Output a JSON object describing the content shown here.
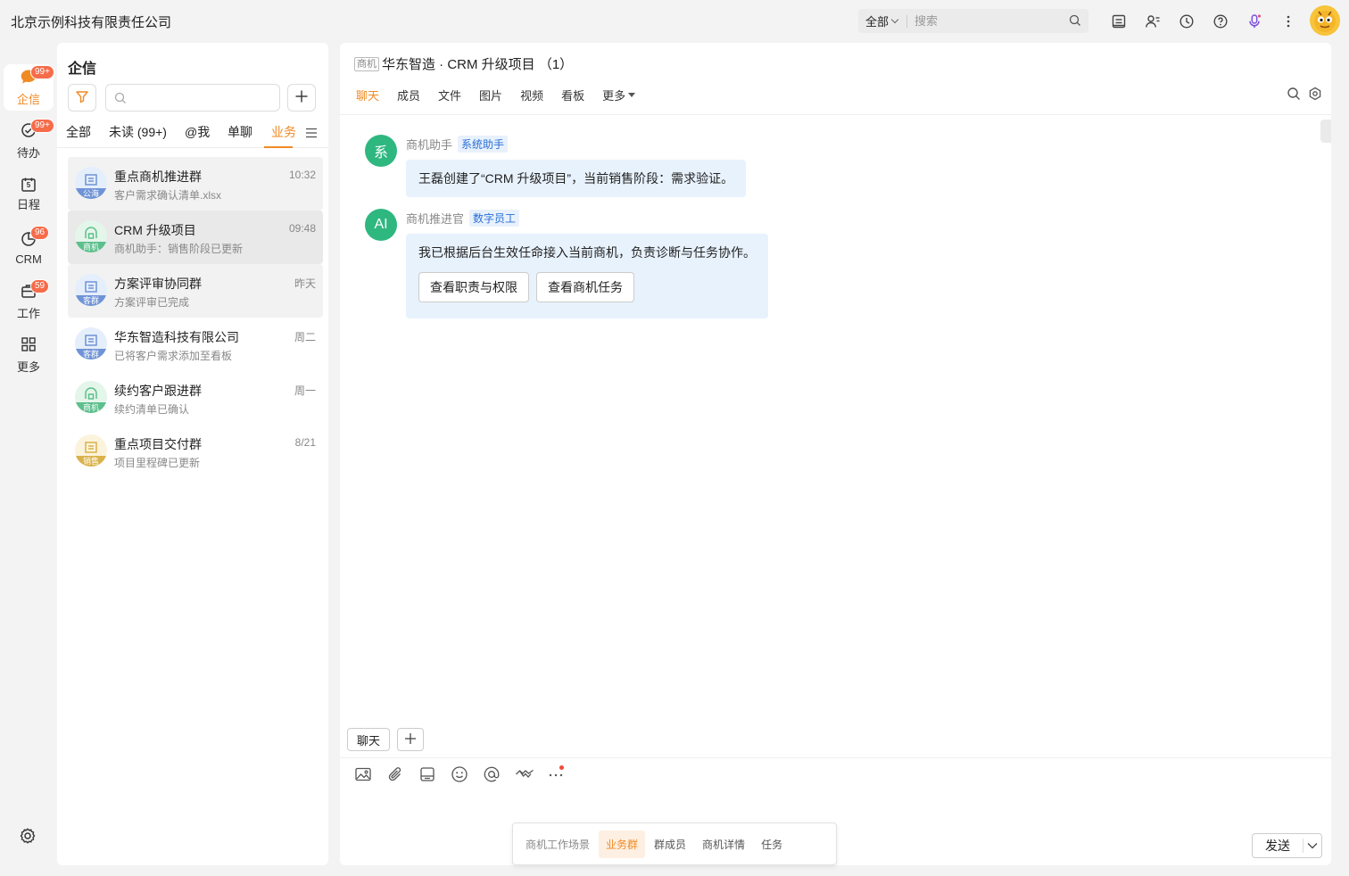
{
  "colors": {
    "accent": "#f08a24",
    "badge": "#f56c4a",
    "bubble": "#e8f2fd",
    "avatar_green": "#2fb780",
    "role_tag": "#2a6fd6"
  },
  "topbar": {
    "company": "北京示例科技有限责任公司",
    "search_scope": "全部",
    "search_placeholder": "搜索",
    "icons": [
      "notes-icon",
      "contacts-icon",
      "clock-icon",
      "help-icon",
      "mic-icon",
      "more-vertical-icon"
    ]
  },
  "rail": {
    "items": [
      {
        "label": "企信",
        "icon": "chat-bubble-icon",
        "badge": "99+"
      },
      {
        "label": "待办",
        "icon": "check-circle-icon",
        "badge": "99+"
      },
      {
        "label": "日程",
        "icon": "calendar-icon",
        "badge": "",
        "day": "5"
      },
      {
        "label": "CRM",
        "icon": "crm-icon",
        "badge": "96"
      },
      {
        "label": "工作",
        "icon": "briefcase-icon",
        "badge": "59"
      },
      {
        "label": "更多",
        "icon": "grid-icon",
        "badge": ""
      }
    ]
  },
  "list": {
    "title": "企信",
    "tabs": [
      "全部",
      "未读 (99+)",
      "@我",
      "单聊",
      "业务"
    ],
    "active_tab": "业务",
    "conversations": [
      {
        "name": "重点商机推进群",
        "time": "10:32",
        "preview": "客户需求确认清单.xlsx",
        "tag": "公海",
        "color": "#6f93d6",
        "bg": "#e5eefb"
      },
      {
        "name": "CRM 升级项目",
        "time": "09:48",
        "preview": "商机助手：销售阶段已更新",
        "tag": "商机",
        "color": "#5dbf8c",
        "bg": "#e4f5ea"
      },
      {
        "name": "方案评审协同群",
        "time": "昨天",
        "preview": "方案评审已完成",
        "tag": "客群",
        "color": "#6f93d6",
        "bg": "#e5eefb"
      },
      {
        "name": "华东智造科技有限公司",
        "time": "周二",
        "preview": "已将客户需求添加至看板",
        "tag": "客群",
        "color": "#6f93d6",
        "bg": "#e5eefb"
      },
      {
        "name": "续约客户跟进群",
        "time": "周一",
        "preview": "续约清单已确认",
        "tag": "商机",
        "color": "#5dbf8c",
        "bg": "#e4f5ea"
      },
      {
        "name": "重点项目交付群",
        "time": "8/21",
        "preview": "项目里程碑已更新",
        "tag": "销售",
        "color": "#d9b24a",
        "bg": "#fbf3dc"
      }
    ]
  },
  "chat": {
    "type_tag": "商机",
    "title": "华东智造 · CRM 升级项目 （1）",
    "tabs": [
      "聊天",
      "成员",
      "文件",
      "图片",
      "视频",
      "看板",
      "更多"
    ],
    "active_tab": "聊天",
    "messages": [
      {
        "avatar": "系",
        "sender": "商机助手",
        "role": "系统助手",
        "text": "王磊创建了“CRM 升级项目”，当前销售阶段：需求验证。"
      },
      {
        "avatar": "AI",
        "sender": "商机推进官",
        "role": "数字员工",
        "text": "我已根据后台生效任命接入当前商机，负责诊断与任务协作。",
        "buttons": [
          "查看职责与权限",
          "查看商机任务"
        ]
      }
    ],
    "input_chip": "聊天",
    "toolbar_icons": [
      "image-icon",
      "attachment-icon",
      "folder-icon",
      "emoji-icon",
      "at-icon",
      "handshake-icon",
      "more-dots-icon"
    ],
    "send_label": "发送"
  },
  "floatbar": {
    "items": [
      "商机工作场景",
      "业务群",
      "群成员",
      "商机详情",
      "任务"
    ],
    "active": "业务群"
  }
}
